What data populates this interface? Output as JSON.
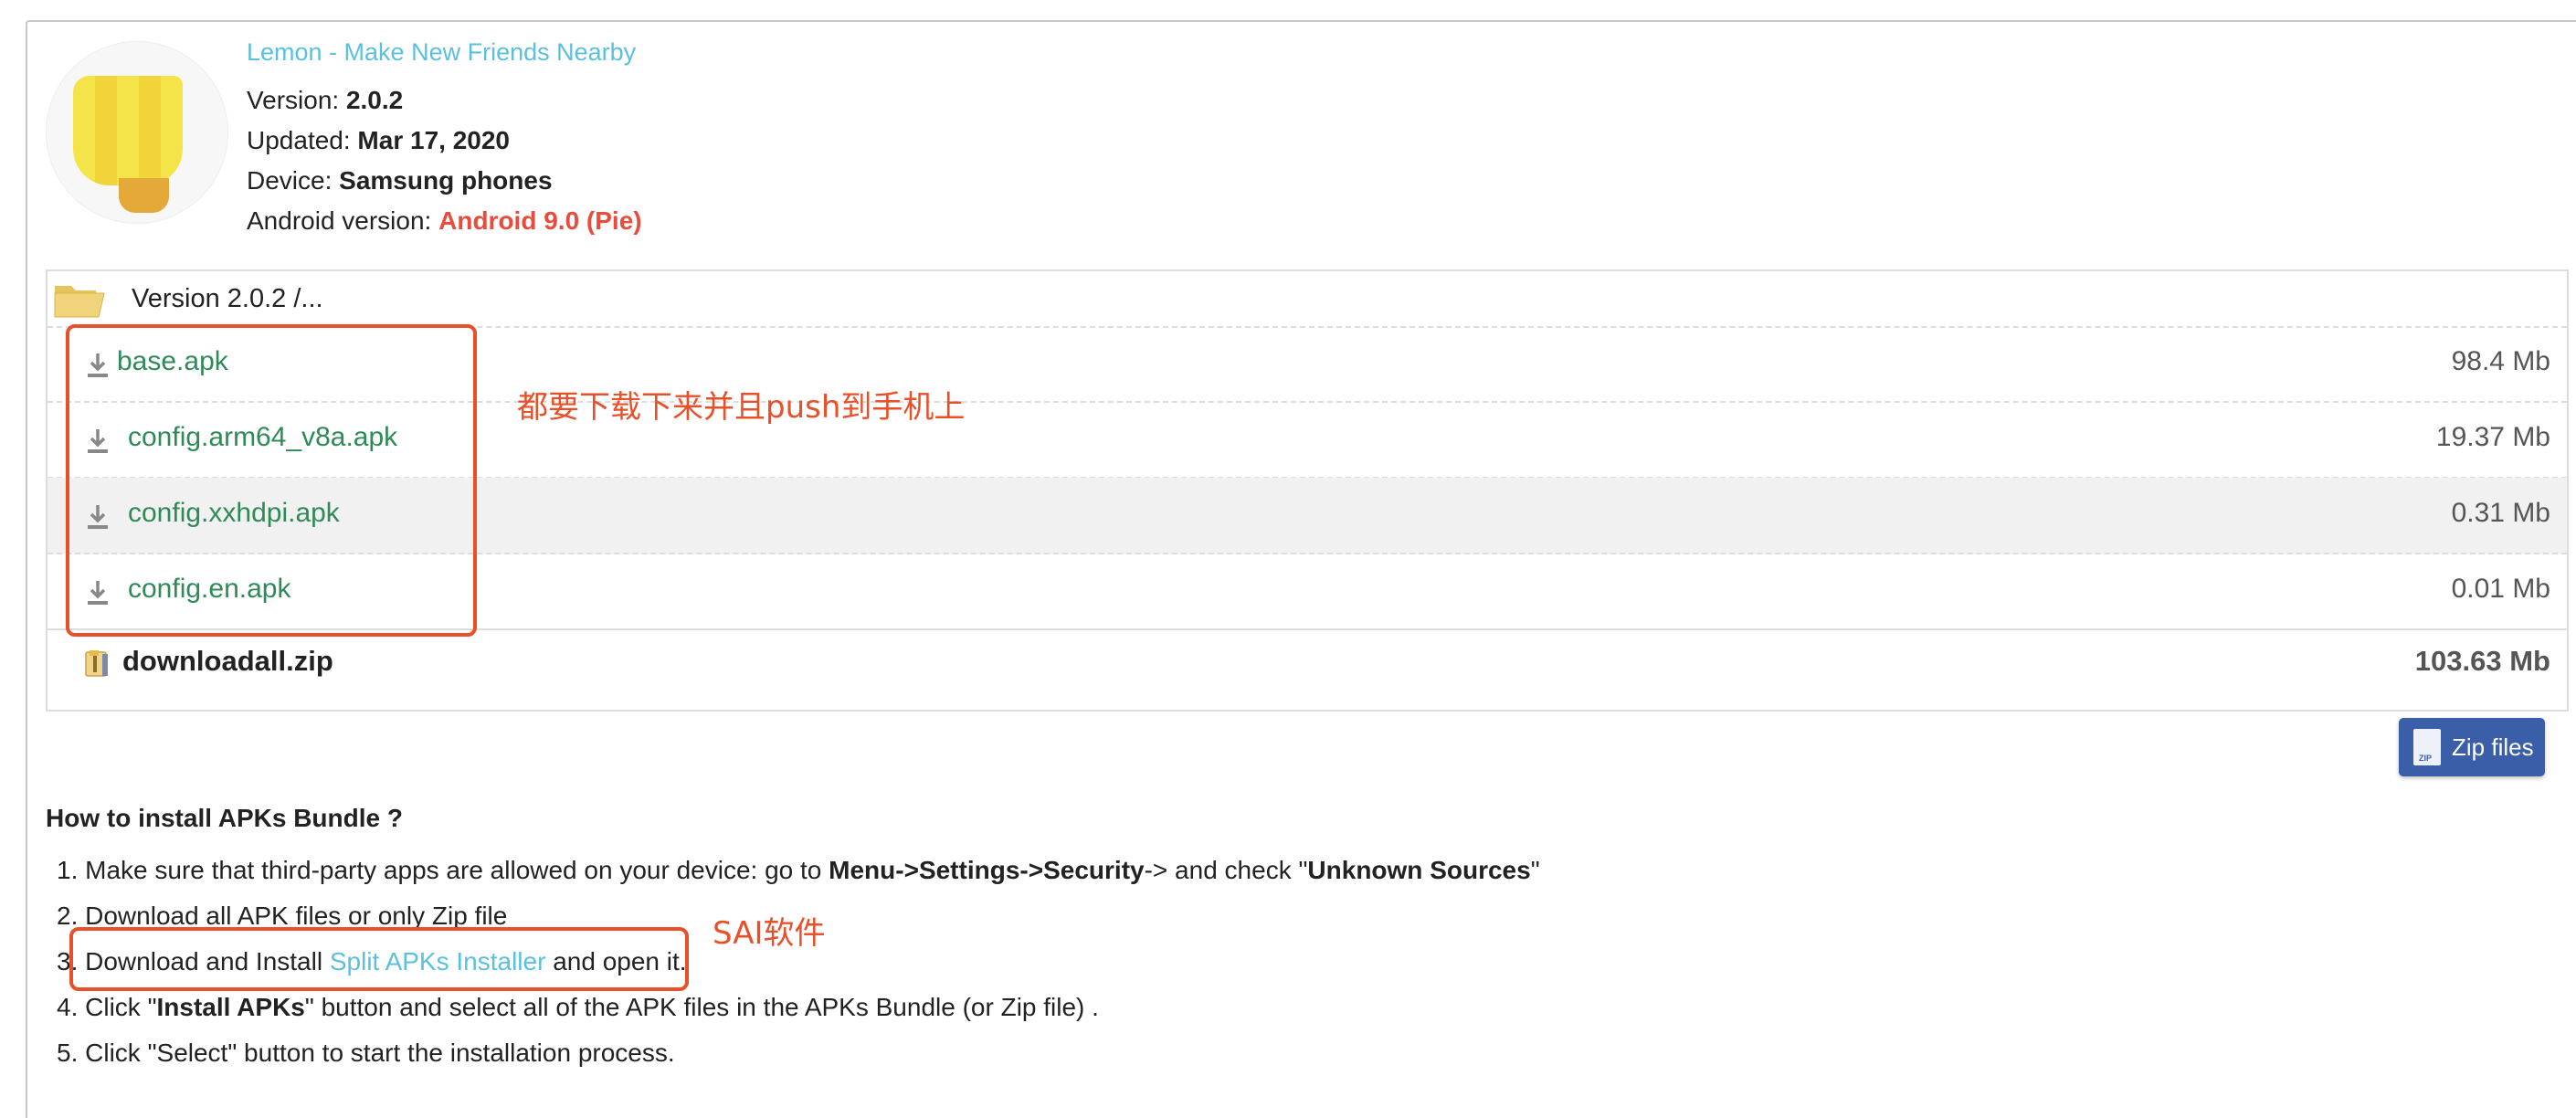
{
  "app": {
    "name": "Lemon - Make New Friends Nearby",
    "version_label": "Version:",
    "version": "2.0.2",
    "updated_label": "Updated:",
    "updated": "Mar 17, 2020",
    "device_label": "Device:",
    "device": "Samsung phones",
    "android_label": "Android version:",
    "android": "Android 9.0 (Pie)"
  },
  "files": {
    "folder": "Version 2.0.2 /...",
    "items": [
      {
        "name": "base.apk",
        "size": "98.4 Mb"
      },
      {
        "name": "config.arm64_v8a.apk",
        "size": "19.37 Mb"
      },
      {
        "name": "config.xxhdpi.apk",
        "size": "0.31 Mb"
      },
      {
        "name": "config.en.apk",
        "size": "0.01 Mb"
      }
    ],
    "zip": {
      "name": "downloadall.zip",
      "size": "103.63 Mb"
    }
  },
  "zip_button": {
    "label": "Zip files",
    "icon_text": "ZIP"
  },
  "howto": {
    "title": "How to install APKs Bundle ?",
    "steps": {
      "s1_a": "1. Make sure that third-party apps are allowed on your device: go to ",
      "s1_menu": "Menu",
      "s1_arrow1": "->",
      "s1_settings": "Settings",
      "s1_arrow2": "->",
      "s1_security": "Security",
      "s1_b": "-> and check \"",
      "s1_unknown": "Unknown Sources",
      "s1_c": "\"",
      "s2": "2. Download all APK files or only Zip file",
      "s3_a": "3. Download and Install ",
      "s3_link": "Split APKs Installer",
      "s3_b": " and open it.",
      "s4_a": "4. Click \"",
      "s4_bold": "Install APKs",
      "s4_b": "\" button and select all of the APK files in the APKs Bundle (or Zip file) .",
      "s5": "5. Click \"Select\" button to start the installation process."
    }
  },
  "annotations": {
    "files_note": "都要下载下来并且push到手机上",
    "sai_note": "SAI软件",
    "color": "#e8502a"
  }
}
